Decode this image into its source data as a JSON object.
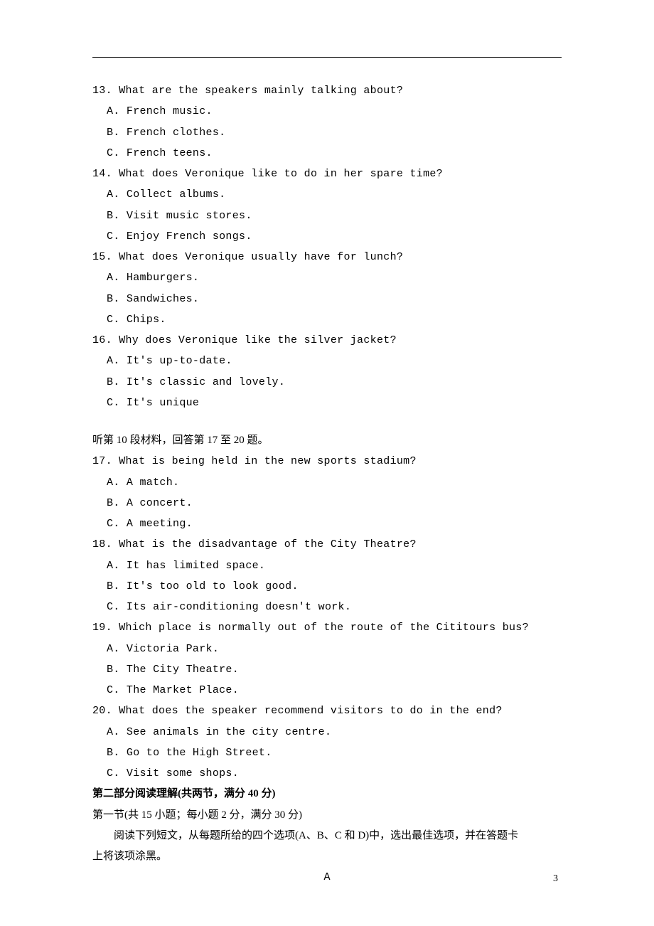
{
  "questions_group1": [
    {
      "num": "13.",
      "text": "What are the speakers mainly talking about?",
      "options": [
        "A. French music.",
        "B. French clothes.",
        "C. French teens."
      ]
    },
    {
      "num": "14.",
      "text": "What does Veronique like to do in her spare time?",
      "options": [
        "A. Collect albums.",
        "B. Visit music stores.",
        "C. Enjoy French songs."
      ]
    },
    {
      "num": "15.",
      "text": "What does Veronique usually have for lunch?",
      "options": [
        "A. Hamburgers.",
        "B. Sandwiches.",
        "C. Chips."
      ]
    },
    {
      "num": "16.",
      "text": "Why does Veronique like the silver jacket?",
      "options": [
        "A. It's up-to-date.",
        "B. It's classic and lovely.",
        "C. It's unique"
      ]
    }
  ],
  "section_intro": "听第 10 段材料，回答第 17 至 20 题。",
  "questions_group2": [
    {
      "num": "17.",
      "text": "What is being held in the new sports stadium?",
      "options": [
        "A. A match.",
        "B. A concert.",
        "C. A meeting."
      ]
    },
    {
      "num": "18.",
      "text": "What is the disadvantage of the City Theatre?",
      "options": [
        "A. It has limited space.",
        "B. It's too old to look good.",
        "C. Its air-conditioning doesn't work."
      ]
    },
    {
      "num": "19.",
      "text": "Which place is normally out of the route of the Cititours bus?",
      "options": [
        "A. Victoria Park.",
        "B. The City Theatre.",
        "C. The Market Place."
      ]
    },
    {
      "num": "20.",
      "text": "What does the speaker recommend visitors to do in the end?",
      "options": [
        "A. See animals in the city centre.",
        "B. Go to the High Street.",
        "C. Visit some shops."
      ]
    }
  ],
  "part2_header": "第二部分阅读理解(共两节，满分 40 分)",
  "subsection_text": "第一节(共 15 小题；每小题 2 分，满分 30 分)",
  "instruction_line1": "阅读下列短文，从每题所给的四个选项(A、B、C 和 D)中，选出最佳选项，并在答题卡",
  "instruction_line2": "上将该项涂黑。",
  "passage_letter": "A",
  "page_number": "3"
}
